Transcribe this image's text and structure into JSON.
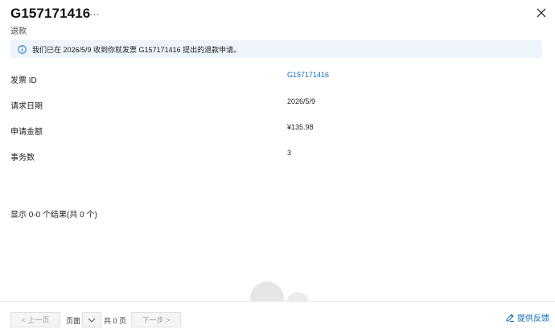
{
  "header": {
    "title": "G157171416",
    "more_label": "···",
    "subtitle": "退款"
  },
  "banner": {
    "message": "我们已在 2026/5/9 收到你就发票 G157171416 提出的退款申请。"
  },
  "fields": [
    {
      "label": "发票 ID",
      "value": "G157171416"
    },
    {
      "label": "请求日期",
      "value": "2026/5/9"
    },
    {
      "label": "申请金额",
      "value": "¥135.98"
    },
    {
      "label": "事务数",
      "value": "3"
    }
  ],
  "results_text": "显示 0-0 个结果(共 0 个)",
  "pagination": {
    "prev_label": "< 上一页",
    "page_label": "页面",
    "total_label": "共 0 页",
    "next_label": "下一步 >"
  },
  "feedback_label": "提供反馈",
  "colors": {
    "accent": "#0f6cbd",
    "banner_bg": "#eef4fb"
  }
}
